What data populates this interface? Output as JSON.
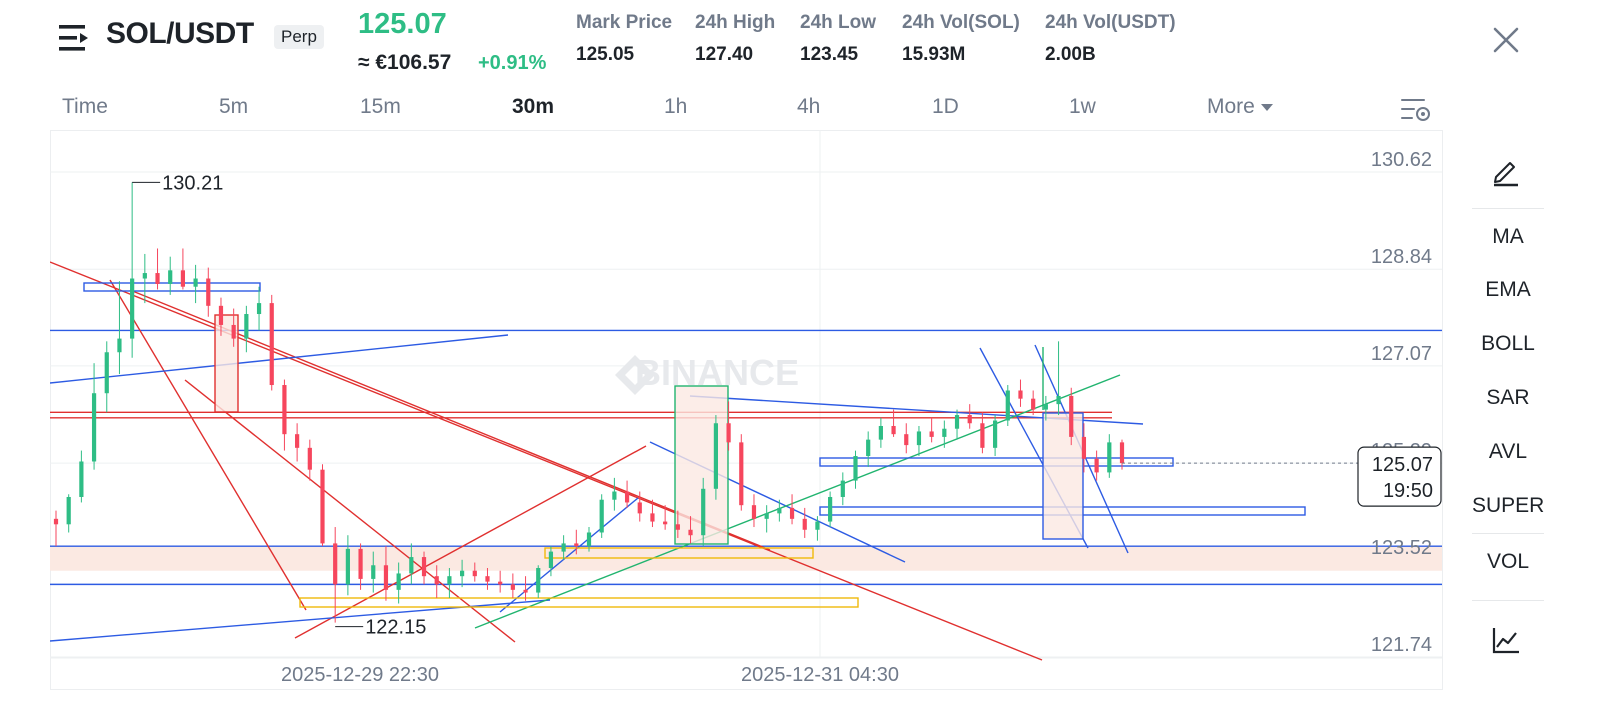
{
  "header": {
    "symbol": "SOL/USDT",
    "contract_type": "Perp",
    "last_price": "125.07",
    "fiat_price": "≈ €106.57",
    "change_percent": "+0.91%",
    "stats": [
      {
        "label": "Mark Price",
        "value": "125.05"
      },
      {
        "label": "24h High",
        "value": "127.40"
      },
      {
        "label": "24h Low",
        "value": "123.45"
      },
      {
        "label": "24h Vol(SOL)",
        "value": "15.93M"
      },
      {
        "label": "24h Vol(USDT)",
        "value": "2.00B"
      }
    ]
  },
  "intervals": {
    "items": [
      "Time",
      "5m",
      "15m",
      "30m",
      "1h",
      "4h",
      "1D",
      "1w",
      "More"
    ],
    "active": "30m"
  },
  "side_toolbar": {
    "items": [
      "MA",
      "EMA",
      "BOLL",
      "SAR",
      "AVL",
      "SUPER",
      "VOL"
    ]
  },
  "colors": {
    "up": "#2ebd85",
    "down": "#f6465d",
    "draw_blue": "#2d5be3",
    "draw_red": "#e0302f",
    "draw_orange": "#f0b90b",
    "draw_green": "#21b46f",
    "zone_fill": "#fbe9e2"
  },
  "chart_data": {
    "type": "candlestick",
    "watermark": "BINANCE",
    "y_ticks": [
      "130.62",
      "128.84",
      "127.07",
      "125.29",
      "123.52",
      "121.74"
    ],
    "ylim": [
      121.74,
      130.62
    ],
    "x_ticks": [
      "2025-12-29 22:30",
      "2025-12-31 04:30"
    ],
    "high_label": "130.21",
    "low_label": "122.15",
    "current_price_label": "125.07",
    "countdown": "19:50",
    "high": 130.21,
    "low": 122.15,
    "last": 125.07,
    "candles": [
      [
        124.05,
        124.2,
        123.55,
        123.95
      ],
      [
        123.95,
        124.5,
        123.8,
        124.45
      ],
      [
        124.45,
        125.3,
        124.35,
        125.1
      ],
      [
        125.1,
        126.9,
        124.95,
        126.35
      ],
      [
        126.35,
        127.3,
        126.0,
        127.1
      ],
      [
        127.1,
        128.4,
        126.7,
        127.35
      ],
      [
        127.35,
        130.21,
        127.0,
        128.45
      ],
      [
        128.45,
        128.9,
        128.0,
        128.55
      ],
      [
        128.55,
        129.0,
        128.25,
        128.35
      ],
      [
        128.35,
        128.85,
        128.15,
        128.6
      ],
      [
        128.6,
        129.0,
        128.25,
        128.3
      ],
      [
        128.3,
        128.7,
        128.0,
        128.45
      ],
      [
        128.45,
        128.65,
        127.75,
        127.95
      ],
      [
        127.95,
        128.1,
        127.4,
        127.6
      ],
      [
        127.6,
        127.9,
        127.2,
        127.35
      ],
      [
        127.35,
        127.95,
        127.1,
        127.8
      ],
      [
        127.8,
        128.3,
        127.5,
        128.0
      ],
      [
        128.0,
        128.15,
        126.4,
        126.5
      ],
      [
        126.5,
        126.6,
        125.3,
        125.6
      ],
      [
        125.6,
        125.8,
        125.1,
        125.35
      ],
      [
        125.35,
        125.5,
        124.75,
        124.95
      ],
      [
        124.95,
        125.05,
        123.55,
        123.6
      ],
      [
        123.6,
        123.9,
        122.15,
        122.85
      ],
      [
        122.85,
        123.75,
        122.65,
        123.5
      ],
      [
        123.5,
        123.6,
        122.75,
        122.95
      ],
      [
        122.95,
        123.45,
        122.7,
        123.2
      ],
      [
        123.2,
        123.55,
        122.55,
        122.75
      ],
      [
        122.75,
        123.25,
        122.5,
        123.05
      ],
      [
        123.05,
        123.6,
        122.85,
        123.35
      ],
      [
        123.35,
        123.45,
        122.85,
        123.0
      ],
      [
        123.0,
        123.2,
        122.6,
        122.85
      ],
      [
        122.85,
        123.15,
        122.6,
        123.0
      ],
      [
        123.0,
        123.3,
        122.8,
        123.1
      ],
      [
        123.1,
        123.25,
        122.9,
        123.0
      ],
      [
        123.0,
        123.15,
        122.75,
        122.9
      ],
      [
        122.9,
        123.1,
        122.7,
        122.85
      ],
      [
        122.85,
        123.05,
        122.6,
        122.75
      ],
      [
        122.75,
        123.0,
        122.55,
        122.7
      ],
      [
        122.7,
        123.2,
        122.6,
        123.15
      ],
      [
        123.15,
        123.55,
        123.0,
        123.45
      ],
      [
        123.45,
        123.75,
        123.3,
        123.6
      ],
      [
        123.6,
        123.85,
        123.4,
        123.55
      ],
      [
        123.55,
        123.9,
        123.45,
        123.8
      ],
      [
        123.8,
        124.5,
        123.7,
        124.4
      ],
      [
        124.4,
        124.8,
        124.2,
        124.55
      ],
      [
        124.55,
        124.75,
        124.25,
        124.35
      ],
      [
        124.35,
        124.55,
        124.0,
        124.15
      ],
      [
        124.15,
        124.4,
        123.9,
        124.0
      ],
      [
        124.0,
        124.3,
        123.85,
        123.95
      ],
      [
        123.95,
        124.2,
        123.7,
        123.85
      ],
      [
        123.85,
        124.1,
        123.6,
        123.75
      ],
      [
        123.75,
        124.8,
        123.55,
        124.6
      ],
      [
        124.6,
        125.95,
        124.4,
        125.8
      ],
      [
        125.8,
        126.2,
        125.3,
        125.45
      ],
      [
        125.45,
        125.6,
        124.2,
        124.3
      ],
      [
        124.3,
        124.5,
        123.9,
        124.05
      ],
      [
        124.05,
        124.3,
        123.8,
        124.15
      ],
      [
        124.15,
        124.4,
        124.0,
        124.25
      ],
      [
        124.25,
        124.5,
        123.95,
        124.05
      ],
      [
        124.05,
        124.25,
        123.7,
        123.85
      ],
      [
        123.85,
        124.1,
        123.65,
        124.0
      ],
      [
        124.0,
        124.55,
        123.9,
        124.45
      ],
      [
        124.45,
        124.9,
        124.3,
        124.75
      ],
      [
        124.75,
        125.3,
        124.6,
        125.2
      ],
      [
        125.2,
        125.65,
        125.0,
        125.5
      ],
      [
        125.5,
        125.9,
        125.35,
        125.75
      ],
      [
        125.75,
        126.05,
        125.55,
        125.6
      ],
      [
        125.6,
        125.8,
        125.25,
        125.4
      ],
      [
        125.4,
        125.75,
        125.2,
        125.65
      ],
      [
        125.65,
        125.9,
        125.45,
        125.55
      ],
      [
        125.55,
        125.85,
        125.35,
        125.7
      ],
      [
        125.7,
        126.05,
        125.5,
        125.95
      ],
      [
        125.95,
        126.15,
        125.7,
        125.8
      ],
      [
        125.8,
        126.0,
        125.25,
        125.35
      ],
      [
        125.35,
        125.95,
        125.2,
        125.85
      ],
      [
        125.85,
        126.5,
        125.75,
        126.4
      ],
      [
        126.4,
        126.6,
        126.1,
        126.25
      ],
      [
        126.25,
        126.4,
        125.95,
        126.05
      ],
      [
        126.05,
        126.3,
        125.85,
        126.15
      ],
      [
        126.15,
        127.3,
        125.95,
        126.3
      ],
      [
        126.3,
        126.45,
        125.4,
        125.55
      ],
      [
        125.55,
        125.8,
        124.9,
        125.15
      ],
      [
        125.15,
        125.3,
        124.75,
        124.9
      ],
      [
        124.9,
        125.6,
        124.8,
        125.45
      ],
      [
        125.45,
        125.5,
        124.95,
        125.07
      ]
    ]
  }
}
